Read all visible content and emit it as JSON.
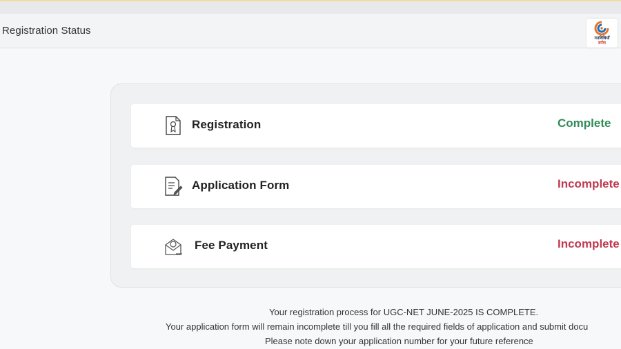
{
  "header": {
    "title": "Registration Status",
    "logo": {
      "icon": "doordarshan-logo",
      "line1": "गतविधियाँ",
      "line2": "दर्पण"
    }
  },
  "rows": [
    {
      "icon": "certificate-document-icon",
      "label": "Registration",
      "status": "Complete",
      "status_color": "#2e8b57"
    },
    {
      "icon": "form-edit-icon",
      "label": "Application Form",
      "status": "Incomplete",
      "status_color": "#c0394f"
    },
    {
      "icon": "payment-envelope-icon",
      "label": "Fee Payment",
      "status": "Incomplete",
      "status_color": "#c0394f"
    }
  ],
  "messages": [
    "Your registration process for UGC-NET JUNE-2025 IS COMPLETE.",
    "Your application form will remain incomplete till you fill all the required fields of application and submit docu",
    "Please note down your application number for your future reference"
  ]
}
